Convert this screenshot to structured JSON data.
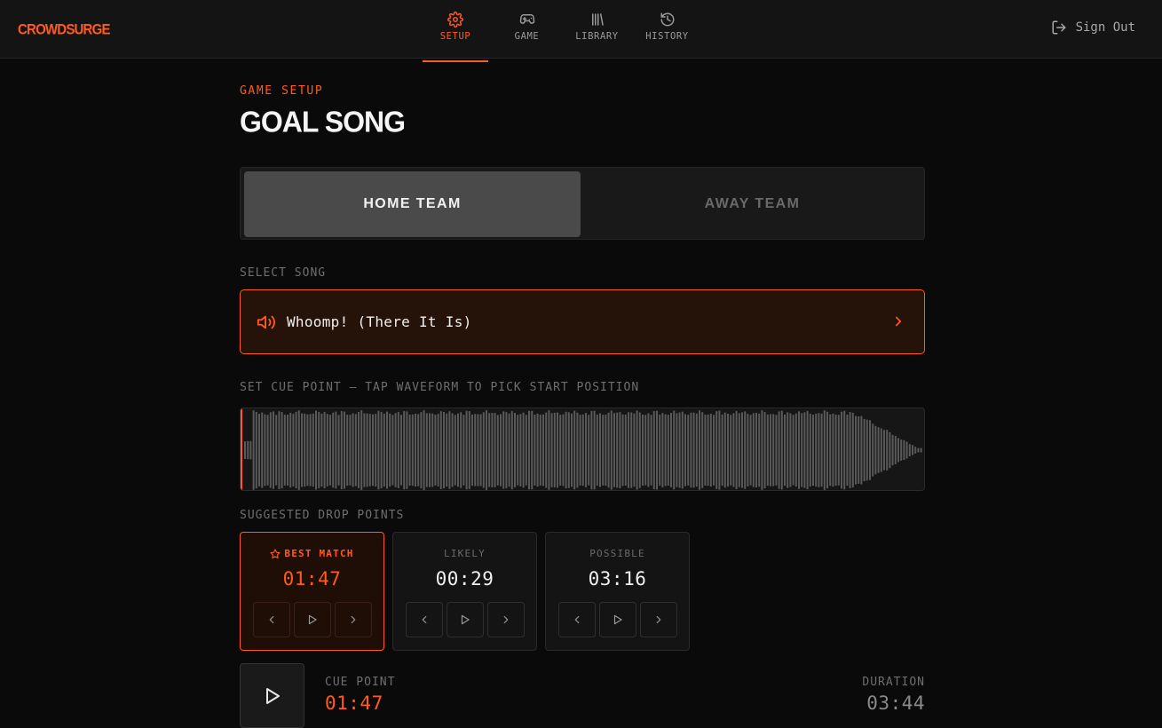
{
  "app": {
    "logo": "CROWDSURGE"
  },
  "nav": {
    "items": [
      {
        "label": "SETUP",
        "icon": "gear-icon",
        "active": true
      },
      {
        "label": "GAME",
        "icon": "gamepad-icon",
        "active": false
      },
      {
        "label": "LIBRARY",
        "icon": "library-icon",
        "active": false
      },
      {
        "label": "HISTORY",
        "icon": "history-icon",
        "active": false
      }
    ],
    "sign_out": "Sign Out"
  },
  "page": {
    "eyebrow": "GAME SETUP",
    "title": "GOAL SONG"
  },
  "teams": {
    "home": "HOME TEAM",
    "away": "AWAY TEAM",
    "selected": "home"
  },
  "song": {
    "label": "SELECT SONG",
    "name": "Whoomp! (There It Is)"
  },
  "cue": {
    "label": "SET CUE POINT — TAP WAVEFORM TO PICK START POSITION"
  },
  "drops": {
    "label": "SUGGESTED DROP POINTS",
    "items": [
      {
        "kind": "BEST MATCH",
        "time": "01:47"
      },
      {
        "kind": "LIKELY",
        "time": "00:29"
      },
      {
        "kind": "POSSIBLE",
        "time": "03:16"
      }
    ]
  },
  "player": {
    "cue_label": "CUE POINT",
    "cue_value": "01:47",
    "duration_label": "DURATION",
    "duration_value": "03:44"
  },
  "colors": {
    "accent": "#ff5a1f",
    "background": "#0a0a0a",
    "panel": "#141414"
  }
}
